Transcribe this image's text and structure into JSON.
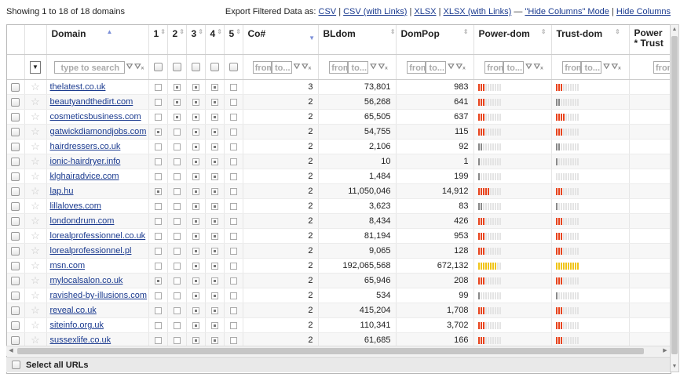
{
  "status": "Showing 1 to 18 of 18 domains",
  "export": {
    "label": "Export Filtered Data as:",
    "csv": "CSV",
    "csv_links": "CSV (with Links)",
    "xlsx": "XLSX",
    "xlsx_links": "XLSX (with Links)",
    "dash": "—",
    "hide_mode": "\"Hide Columns\" Mode",
    "hide_cols": "Hide Columns"
  },
  "columns": {
    "domain": "Domain",
    "c1": "1",
    "c2": "2",
    "c3": "3",
    "c4": "4",
    "c5": "5",
    "co": "Co#",
    "bldom": "BLdom",
    "dompop": "DomPop",
    "power": "Power-dom",
    "trust": "Trust-dom",
    "pt_line1": "Power",
    "pt_line2": "* Trust"
  },
  "filters": {
    "domain_placeholder": "type to search",
    "from": "from",
    "to": "to...",
    "dd": "▼"
  },
  "colors": {
    "red": "#e8431c",
    "yellow": "#f0c419",
    "gray": "#888888",
    "empty": "#e4e4e4"
  },
  "rows": [
    {
      "domain": "thelatest.co.uk",
      "m": [
        0,
        1,
        1,
        1,
        0
      ],
      "co": "3",
      "bl": "73,801",
      "pop": "983",
      "p": [
        3,
        "red"
      ],
      "t": [
        3,
        "red"
      ]
    },
    {
      "domain": "beautyandthedirt.com",
      "m": [
        0,
        1,
        1,
        1,
        0
      ],
      "co": "2",
      "bl": "56,268",
      "pop": "641",
      "p": [
        3,
        "red"
      ],
      "t": [
        2,
        "gray"
      ]
    },
    {
      "domain": "cosmeticsbusiness.com",
      "m": [
        0,
        1,
        1,
        1,
        0
      ],
      "co": "2",
      "bl": "65,505",
      "pop": "637",
      "p": [
        3,
        "red"
      ],
      "t": [
        4,
        "red"
      ]
    },
    {
      "domain": "gatwickdiamondjobs.com",
      "m": [
        1,
        0,
        1,
        1,
        0
      ],
      "co": "2",
      "bl": "54,755",
      "pop": "115",
      "p": [
        3,
        "red"
      ],
      "t": [
        3,
        "red"
      ]
    },
    {
      "domain": "hairdressers.co.uk",
      "m": [
        0,
        0,
        1,
        1,
        0
      ],
      "co": "2",
      "bl": "2,106",
      "pop": "92",
      "p": [
        2,
        "gray"
      ],
      "t": [
        2,
        "gray"
      ]
    },
    {
      "domain": "ionic-hairdryer.info",
      "m": [
        0,
        0,
        1,
        1,
        0
      ],
      "co": "2",
      "bl": "10",
      "pop": "1",
      "p": [
        1,
        "gray"
      ],
      "t": [
        1,
        "gray"
      ]
    },
    {
      "domain": "klghairadvice.com",
      "m": [
        0,
        0,
        1,
        1,
        0
      ],
      "co": "2",
      "bl": "1,484",
      "pop": "199",
      "p": [
        1,
        "gray"
      ],
      "t": [
        0,
        "gray"
      ]
    },
    {
      "domain": "lap.hu",
      "m": [
        1,
        0,
        1,
        1,
        0
      ],
      "co": "2",
      "bl": "11,050,046",
      "pop": "14,912",
      "p": [
        5,
        "red"
      ],
      "t": [
        3,
        "red"
      ]
    },
    {
      "domain": "lillaloves.com",
      "m": [
        0,
        0,
        1,
        1,
        0
      ],
      "co": "2",
      "bl": "3,623",
      "pop": "83",
      "p": [
        2,
        "gray"
      ],
      "t": [
        1,
        "gray"
      ]
    },
    {
      "domain": "londondrum.com",
      "m": [
        0,
        0,
        1,
        1,
        0
      ],
      "co": "2",
      "bl": "8,434",
      "pop": "426",
      "p": [
        3,
        "red"
      ],
      "t": [
        3,
        "red"
      ]
    },
    {
      "domain": "lorealprofessionnel.co.uk",
      "m": [
        0,
        0,
        1,
        1,
        0
      ],
      "co": "2",
      "bl": "81,194",
      "pop": "953",
      "p": [
        3,
        "red"
      ],
      "t": [
        3,
        "red"
      ]
    },
    {
      "domain": "lorealprofessionnel.pl",
      "m": [
        0,
        0,
        1,
        1,
        0
      ],
      "co": "2",
      "bl": "9,065",
      "pop": "128",
      "p": [
        3,
        "red"
      ],
      "t": [
        3,
        "red"
      ]
    },
    {
      "domain": "msn.com",
      "m": [
        0,
        0,
        1,
        1,
        0
      ],
      "co": "2",
      "bl": "192,065,568",
      "pop": "672,132",
      "p": [
        8,
        "yellow"
      ],
      "t": [
        10,
        "yellow"
      ]
    },
    {
      "domain": "mylocalsalon.co.uk",
      "m": [
        1,
        0,
        1,
        1,
        0
      ],
      "co": "2",
      "bl": "65,946",
      "pop": "208",
      "p": [
        3,
        "red"
      ],
      "t": [
        3,
        "red"
      ]
    },
    {
      "domain": "ravished-by-illusions.com",
      "m": [
        0,
        0,
        1,
        1,
        0
      ],
      "co": "2",
      "bl": "534",
      "pop": "99",
      "p": [
        1,
        "gray"
      ],
      "t": [
        1,
        "gray"
      ]
    },
    {
      "domain": "reveal.co.uk",
      "m": [
        0,
        0,
        1,
        1,
        0
      ],
      "co": "2",
      "bl": "415,204",
      "pop": "1,708",
      "p": [
        3,
        "red"
      ],
      "t": [
        3,
        "red"
      ]
    },
    {
      "domain": "siteinfo.org.uk",
      "m": [
        0,
        0,
        1,
        1,
        0
      ],
      "co": "2",
      "bl": "110,341",
      "pop": "3,702",
      "p": [
        3,
        "red"
      ],
      "t": [
        3,
        "red"
      ]
    },
    {
      "domain": "sussexlife.co.uk",
      "m": [
        0,
        0,
        1,
        1,
        0
      ],
      "co": "2",
      "bl": "61,685",
      "pop": "166",
      "p": [
        3,
        "red"
      ],
      "t": [
        3,
        "red"
      ]
    }
  ],
  "select_all": "Select all URLs"
}
